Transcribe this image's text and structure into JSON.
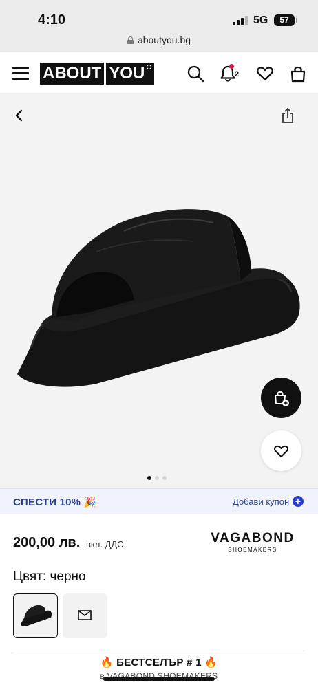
{
  "status_bar": {
    "time": "4:10",
    "network": "5G",
    "battery": "57"
  },
  "browser": {
    "url": "aboutyou.bg"
  },
  "header": {
    "logo_part1": "ABOUT",
    "logo_part2": "YOU",
    "notification_count": "2",
    "icons": [
      "menu-icon",
      "search-icon",
      "bell-icon",
      "heart-icon",
      "bag-icon"
    ]
  },
  "gallery": {
    "total_images": 3,
    "active_index": 0
  },
  "promo": {
    "text": "СПЕСТИ 10%",
    "emoji": "🎉",
    "coupon_label": "Добави купон",
    "coupon_plus": "+"
  },
  "product": {
    "price": "200,00 лв.",
    "vat_note": "вкл. ДДС",
    "brand": "VAGABOND",
    "brand_sub": "SHOEMAKERS",
    "color_label": "Цвят: черно"
  },
  "badge": {
    "title": "🔥 БЕСТСЕЛЪР # 1 🔥",
    "subtitle": "в VAGABOND SHOEMAKERS"
  },
  "colors": {
    "accent": "#2c3dcc",
    "promo_bg": "#f0f3fb",
    "notification": "#e0194a"
  }
}
